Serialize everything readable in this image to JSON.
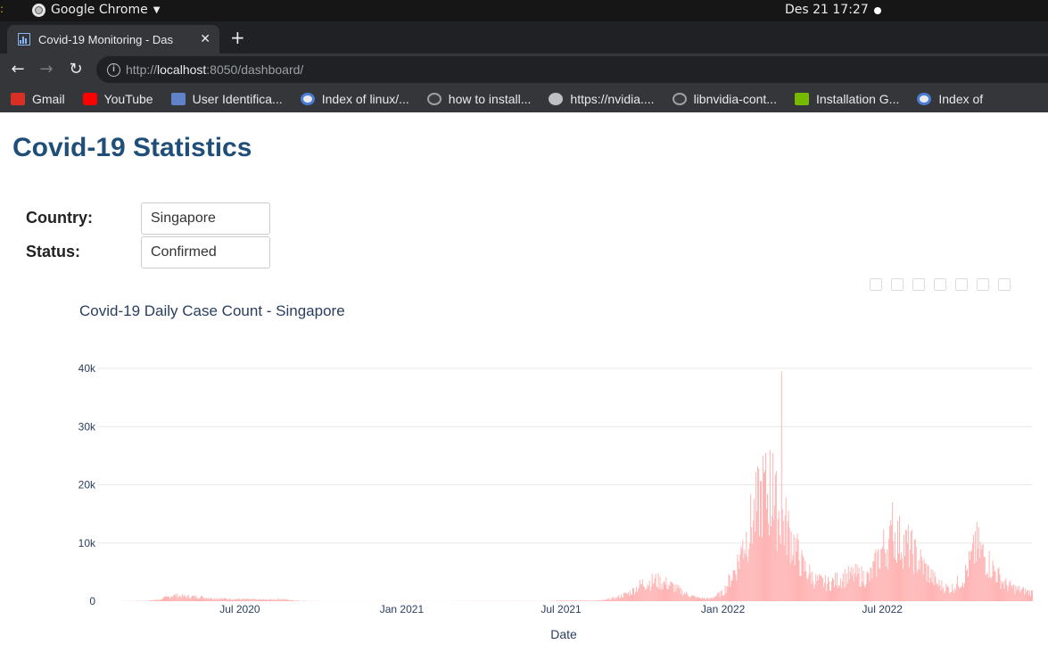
{
  "os": {
    "app_name": "Google Chrome",
    "clock": "Des 21  17:27"
  },
  "browser": {
    "tab_title": "Covid-19 Monitoring - Das",
    "url_scheme": "http://",
    "url_host": "localhost",
    "url_rest": ":8050/dashboard/",
    "bookmarks": [
      {
        "label": "Gmail",
        "icon": "gmail-icon"
      },
      {
        "label": "YouTube",
        "icon": "youtube-icon"
      },
      {
        "label": "User Identifica...",
        "icon": "chart-favicon-icon"
      },
      {
        "label": "Index of linux/...",
        "icon": "index-favicon-icon"
      },
      {
        "label": "how to install...",
        "icon": "github-icon"
      },
      {
        "label": "https://nvidia....",
        "icon": "globe-icon"
      },
      {
        "label": "libnvidia-cont...",
        "icon": "github-icon"
      },
      {
        "label": "Installation G...",
        "icon": "nvidia-icon"
      },
      {
        "label": "Index of",
        "icon": "index-favicon-icon"
      }
    ]
  },
  "page": {
    "title": "Covid-19 Statistics",
    "country_label": "Country:",
    "country_value": "Singapore",
    "status_label": "Status:",
    "status_value": "Confirmed"
  },
  "chart_data": {
    "type": "bar",
    "title": "Covid-19 Daily Case Count - Singapore",
    "xlabel": "Date",
    "ylabel": "",
    "ylim": [
      0,
      42000
    ],
    "yticks": [
      "0",
      "10k",
      "20k",
      "30k",
      "40k"
    ],
    "xtick_labels": [
      "Jul 2020",
      "Jan 2021",
      "Jul 2021",
      "Jan 2022",
      "Jul 2022"
    ],
    "bar_color": "#ffb3b3",
    "x_start": "2020-01-22",
    "x_end": "2022-12-18",
    "grid": true,
    "monthly_series": [
      {
        "month": "2020-01",
        "values": [
          0,
          0
        ]
      },
      {
        "month": "2020-02",
        "values": [
          5,
          5
        ]
      },
      {
        "month": "2020-03",
        "values": [
          30,
          50
        ]
      },
      {
        "month": "2020-04",
        "values": [
          300,
          1000
        ]
      },
      {
        "month": "2020-05",
        "values": [
          800,
          750
        ]
      },
      {
        "month": "2020-06",
        "values": [
          500,
          400
        ]
      },
      {
        "month": "2020-07",
        "values": [
          350,
          300
        ]
      },
      {
        "month": "2020-08",
        "values": [
          250,
          400
        ]
      },
      {
        "month": "2020-09",
        "values": [
          100,
          30
        ]
      },
      {
        "month": "2020-10",
        "values": [
          10,
          10
        ]
      },
      {
        "month": "2020-11",
        "values": [
          10,
          10
        ]
      },
      {
        "month": "2020-12",
        "values": [
          10,
          10
        ]
      },
      {
        "month": "2021-01",
        "values": [
          20,
          20
        ]
      },
      {
        "month": "2021-02",
        "values": [
          10,
          10
        ]
      },
      {
        "month": "2021-03",
        "values": [
          15,
          15
        ]
      },
      {
        "month": "2021-04",
        "values": [
          20,
          25
        ]
      },
      {
        "month": "2021-05",
        "values": [
          30,
          30
        ]
      },
      {
        "month": "2021-06",
        "values": [
          20,
          20
        ]
      },
      {
        "month": "2021-07",
        "values": [
          100,
          150
        ]
      },
      {
        "month": "2021-08",
        "values": [
          80,
          120
        ]
      },
      {
        "month": "2021-09",
        "values": [
          600,
          1400
        ]
      },
      {
        "month": "2021-10",
        "values": [
          3000,
          3500
        ]
      },
      {
        "month": "2021-11",
        "values": [
          2800,
          1500
        ]
      },
      {
        "month": "2021-12",
        "values": [
          600,
          400
        ]
      },
      {
        "month": "2022-01",
        "values": [
          1500,
          6000
        ]
      },
      {
        "month": "2022-02",
        "values": [
          13000,
          19000
        ]
      },
      {
        "month": "2022-03",
        "values": [
          16000,
          12000
        ]
      },
      {
        "month": "2022-04",
        "values": [
          6000,
          3500
        ]
      },
      {
        "month": "2022-05",
        "values": [
          3000,
          4000
        ]
      },
      {
        "month": "2022-06",
        "values": [
          4500,
          4000
        ]
      },
      {
        "month": "2022-07",
        "values": [
          9000,
          11000
        ]
      },
      {
        "month": "2022-08",
        "values": [
          9000,
          6000
        ]
      },
      {
        "month": "2022-09",
        "values": [
          3000,
          2000
        ]
      },
      {
        "month": "2022-10",
        "values": [
          4000,
          9500
        ]
      },
      {
        "month": "2022-11",
        "values": [
          6000,
          3000
        ]
      },
      {
        "month": "2022-12",
        "values": [
          2000,
          1500
        ]
      }
    ],
    "spikes": [
      {
        "date": "2022-02-23",
        "value": 26000
      },
      {
        "date": "2022-02-26",
        "value": 25500
      },
      {
        "date": "2022-03-08",
        "value": 39500
      },
      {
        "date": "2022-01-23",
        "value": 10500
      },
      {
        "date": "2022-07-12",
        "value": 17000
      },
      {
        "date": "2022-10-14",
        "value": 12000
      }
    ]
  }
}
